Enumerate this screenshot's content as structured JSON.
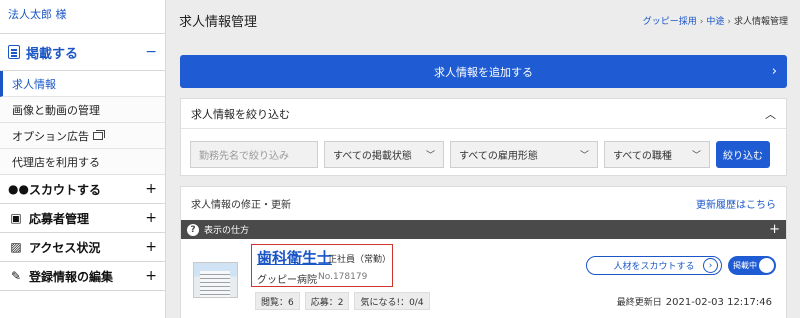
{
  "user": {
    "name": "法人太郎 様"
  },
  "sidebar": {
    "post_section": {
      "label": "掲載する",
      "toggle": "−"
    },
    "post_items": [
      {
        "label": "求人情報"
      },
      {
        "label": "画像と動画の管理"
      },
      {
        "label": "オプション広告"
      },
      {
        "label": "代理店を利用する"
      }
    ],
    "nav": [
      {
        "label": "スカウトする",
        "icon": "binoculars-icon",
        "toggle": "+"
      },
      {
        "label": "応募者管理",
        "icon": "applicant-icon",
        "toggle": "+"
      },
      {
        "label": "アクセス状況",
        "icon": "image-icon",
        "toggle": "+"
      },
      {
        "label": "登録情報の編集",
        "icon": "pencil-icon",
        "toggle": "+"
      }
    ]
  },
  "header": {
    "title": "求人情報管理",
    "breadcrumb": [
      "グッピー採用",
      "中途",
      "求人情報管理"
    ]
  },
  "add_button": {
    "label": "求人情報を追加する"
  },
  "filter": {
    "title": "求人情報を絞り込む",
    "search_placeholder": "勤務先名で絞り込み",
    "selects": [
      "すべての掲載状態",
      "すべての雇用形態",
      "すべての職種"
    ],
    "submit": "絞り込む"
  },
  "list": {
    "title": "求人情報の修正・更新",
    "history_link": "更新履歴はこちら",
    "howto": "表示の仕方"
  },
  "job": {
    "title": "歯科衛生士",
    "employment": "正社員（常勤）",
    "hospital": "グッピー病院",
    "number": "No.178179",
    "stats": [
      "閲覧：6",
      "応募：2",
      "気になる!：0/4"
    ],
    "scout_button": "人材をスカウトする",
    "status_toggle": "掲載中",
    "updated_label": "最終更新日",
    "updated_at": "2021-02-03 12:17:46"
  },
  "colors": {
    "accent": "#1f5bd3",
    "link": "#1a56c6",
    "highlight": "#d0352b",
    "dark_bar": "#4a4a4a"
  }
}
